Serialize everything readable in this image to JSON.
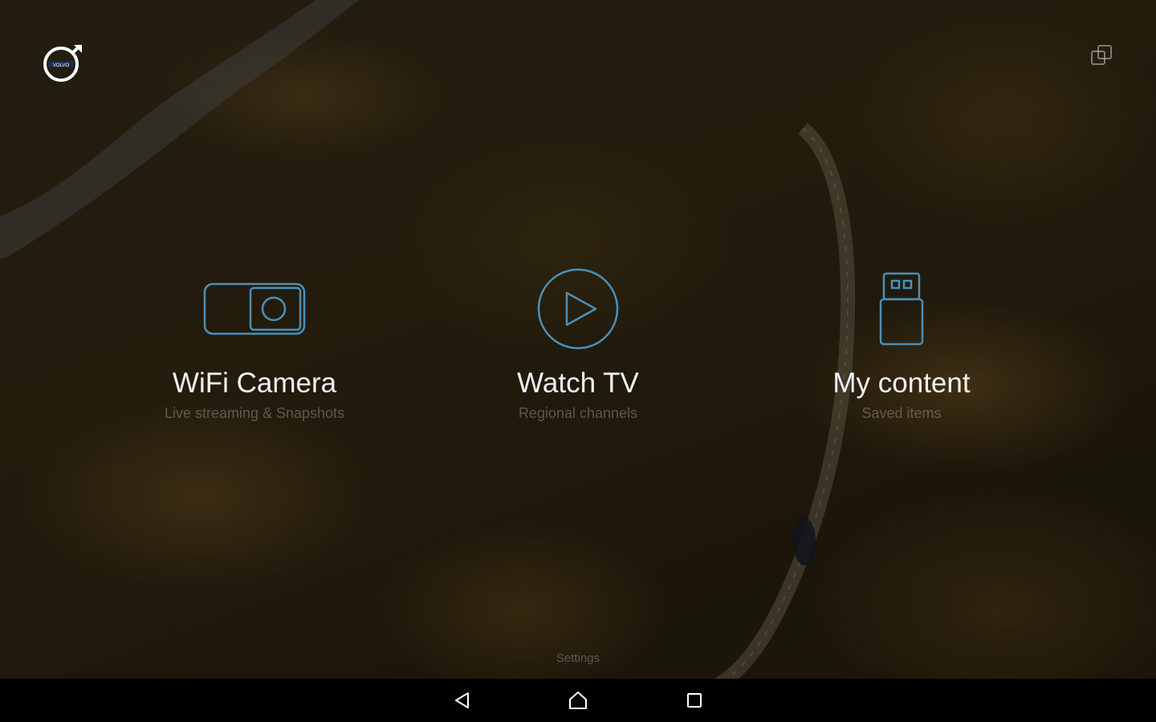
{
  "colors": {
    "icon_stroke": "#4a90b8",
    "title_text": "#f2f2f2",
    "subtitle_text": "#c8c8c8",
    "navbar_bg": "#000000",
    "nav_icon": "#ffffff"
  },
  "header": {
    "logo_icon": "volvo-logo-icon",
    "switch_icon": "window-switch-icon"
  },
  "tiles": [
    {
      "icon": "wifi-camera-icon",
      "title": "WiFi Camera",
      "subtitle": "Live streaming & Snapshots"
    },
    {
      "icon": "play-circle-icon",
      "title": "Watch TV",
      "subtitle": "Regional channels"
    },
    {
      "icon": "usb-drive-icon",
      "title": "My content",
      "subtitle": "Saved items"
    }
  ],
  "footer": {
    "settings_label": "Settings"
  },
  "navbar": {
    "back_icon": "back-triangle-icon",
    "home_icon": "home-icon",
    "recent_icon": "recent-apps-icon"
  }
}
